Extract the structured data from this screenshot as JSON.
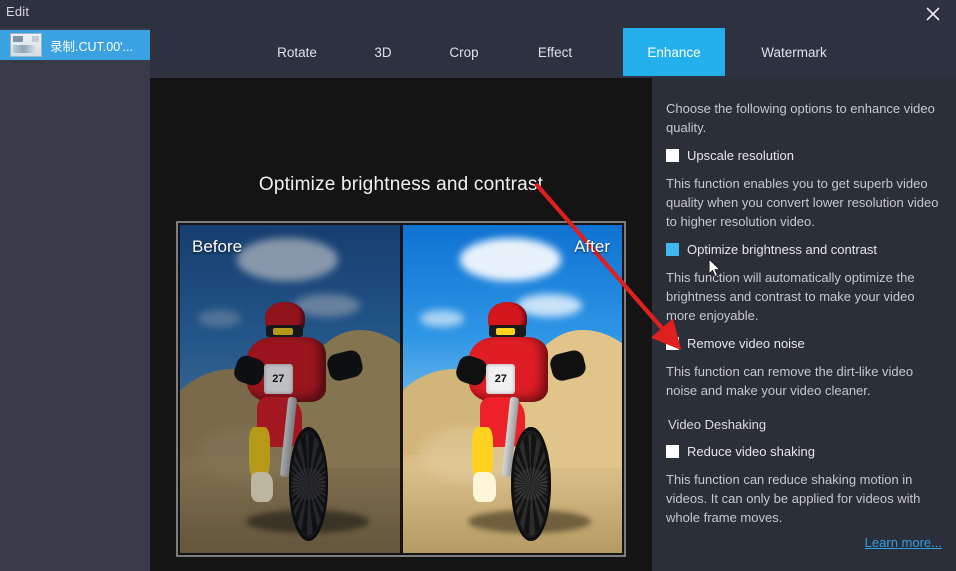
{
  "window": {
    "menu_label": "Edit",
    "close_icon": "close-icon"
  },
  "sidebar": {
    "items": [
      {
        "label": "录制.CUT.00'...",
        "icon": "video-thumbnail-icon",
        "selected": true
      }
    ]
  },
  "tabs": [
    {
      "label": "Rotate",
      "active": false
    },
    {
      "label": "3D",
      "active": false
    },
    {
      "label": "Crop",
      "active": false
    },
    {
      "label": "Effect",
      "active": false
    },
    {
      "label": "Enhance",
      "active": true
    },
    {
      "label": "Watermark",
      "active": false
    }
  ],
  "main": {
    "title": "Optimize brightness and contrast",
    "preview": {
      "before_label": "Before",
      "after_label": "After",
      "bike_number": "27"
    }
  },
  "panel": {
    "intro": "Choose the following options to enhance video quality.",
    "options": [
      {
        "label": "Upscale resolution",
        "checked": false,
        "description": "This function enables you to get superb video quality when you convert lower resolution video to higher resolution video."
      },
      {
        "label": "Optimize brightness and contrast",
        "checked": true,
        "description": "This function will automatically optimize the brightness and contrast to make your video more enjoyable."
      },
      {
        "label": "Remove video noise",
        "checked": false,
        "description": "This function can remove the dirt-like video noise and make your video cleaner."
      }
    ],
    "deshaking": {
      "section_title": "Video Deshaking",
      "label": "Reduce video shaking",
      "checked": false,
      "description": "This function can reduce shaking motion in videos. It can only be applied for videos with whole frame moves."
    },
    "learn_more": "Learn more..."
  },
  "colors": {
    "accent": "#24b0ed",
    "checkbox_on": "#3fb8ef",
    "link": "#2f9fe0",
    "annotation_arrow": "#e01f1f",
    "titlebar_bg": "#2d3140",
    "sidebar_bg": "#383b47",
    "panel_bg": "#2b2f3a",
    "canvas_bg": "#141414"
  }
}
